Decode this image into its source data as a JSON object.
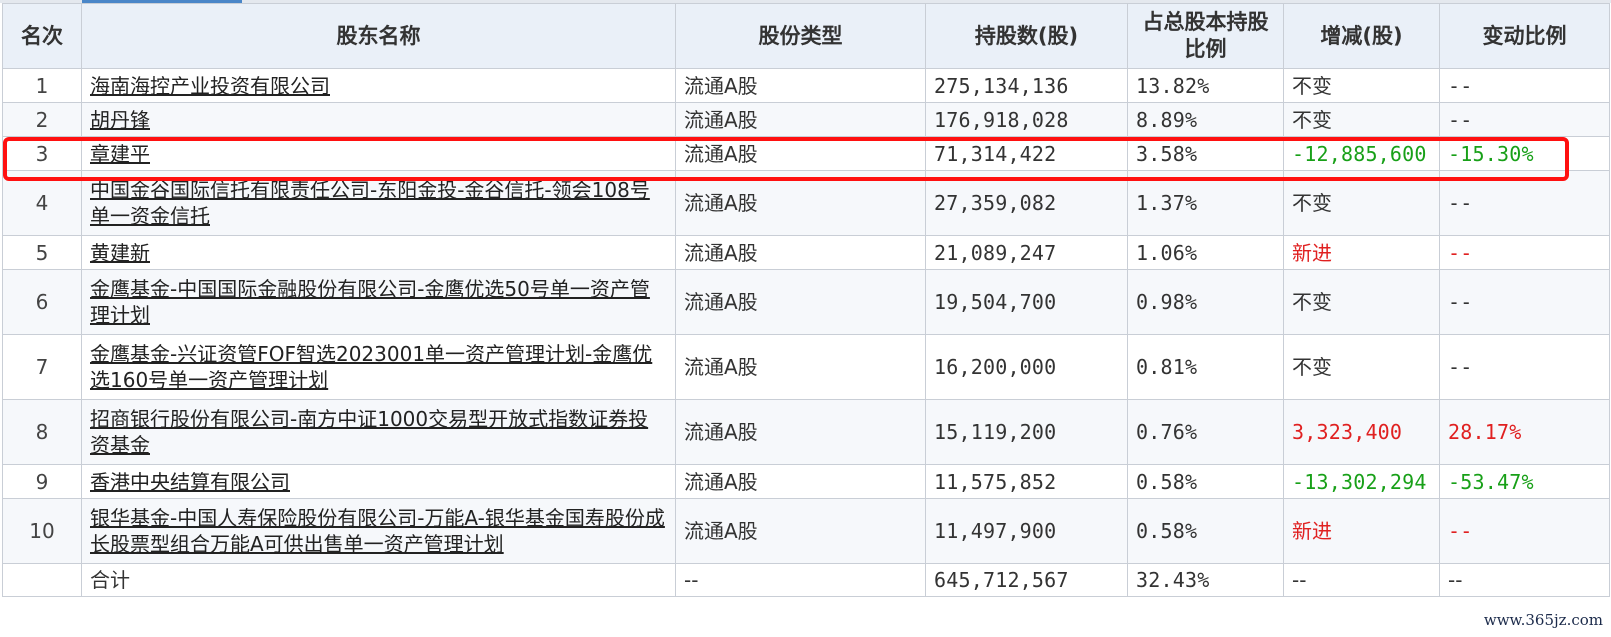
{
  "table": {
    "headers": [
      "名次",
      "股东名称",
      "股份类型",
      "持股数(股)",
      "占总股本持股比例",
      "增减(股)",
      "变动比例"
    ],
    "rows": [
      {
        "rank": "1",
        "name": "海南海控产业投资有限公司",
        "type": "流通A股",
        "shares": "275,134,136",
        "ratio": "13.82%",
        "change": "不变",
        "change_pct": "--",
        "trend": "flat"
      },
      {
        "rank": "2",
        "name": "胡丹锋",
        "type": "流通A股",
        "shares": "176,918,028",
        "ratio": "8.89%",
        "change": "不变",
        "change_pct": "--",
        "trend": "flat"
      },
      {
        "rank": "3",
        "name": "章建平",
        "type": "流通A股",
        "shares": "71,314,422",
        "ratio": "3.58%",
        "change": "-12,885,600",
        "change_pct": "-15.30%",
        "trend": "down"
      },
      {
        "rank": "4",
        "name": "中国金谷国际信托有限责任公司-东阳金投-金谷信托-领会108号单一资金信托",
        "type": "流通A股",
        "shares": "27,359,082",
        "ratio": "1.37%",
        "change": "不变",
        "change_pct": "--",
        "trend": "flat"
      },
      {
        "rank": "5",
        "name": "黄建新",
        "type": "流通A股",
        "shares": "21,089,247",
        "ratio": "1.06%",
        "change": "新进",
        "change_pct": "--",
        "trend": "up"
      },
      {
        "rank": "6",
        "name": "金鹰基金-中国国际金融股份有限公司-金鹰优选50号单一资产管理计划",
        "type": "流通A股",
        "shares": "19,504,700",
        "ratio": "0.98%",
        "change": "不变",
        "change_pct": "--",
        "trend": "flat"
      },
      {
        "rank": "7",
        "name": "金鹰基金-兴证资管FOF智选2023001单一资产管理计划-金鹰优选160号单一资产管理计划",
        "type": "流通A股",
        "shares": "16,200,000",
        "ratio": "0.81%",
        "change": "不变",
        "change_pct": "--",
        "trend": "flat"
      },
      {
        "rank": "8",
        "name": "招商银行股份有限公司-南方中证1000交易型开放式指数证券投资基金",
        "type": "流通A股",
        "shares": "15,119,200",
        "ratio": "0.76%",
        "change": "3,323,400",
        "change_pct": "28.17%",
        "trend": "up"
      },
      {
        "rank": "9",
        "name": "香港中央结算有限公司",
        "type": "流通A股",
        "shares": "11,575,852",
        "ratio": "0.58%",
        "change": "-13,302,294",
        "change_pct": "-53.47%",
        "trend": "down"
      },
      {
        "rank": "10",
        "name": "银华基金-中国人寿保险股份有限公司-万能A-银华基金国寿股份成长股票型组合万能A可供出售单一资产管理计划",
        "type": "流通A股",
        "shares": "11,497,900",
        "ratio": "0.58%",
        "change": "新进",
        "change_pct": "--",
        "trend": "up"
      }
    ],
    "total": {
      "label": "合计",
      "type": "--",
      "shares": "645,712,567",
      "ratio": "32.43%",
      "change": "--",
      "change_pct": "--"
    }
  },
  "watermark": "www.365jz.com",
  "colors": {
    "increase": "#e02020",
    "decrease": "#18a018",
    "header_bg": "#eaf0f8",
    "highlight": "#ff1010"
  }
}
